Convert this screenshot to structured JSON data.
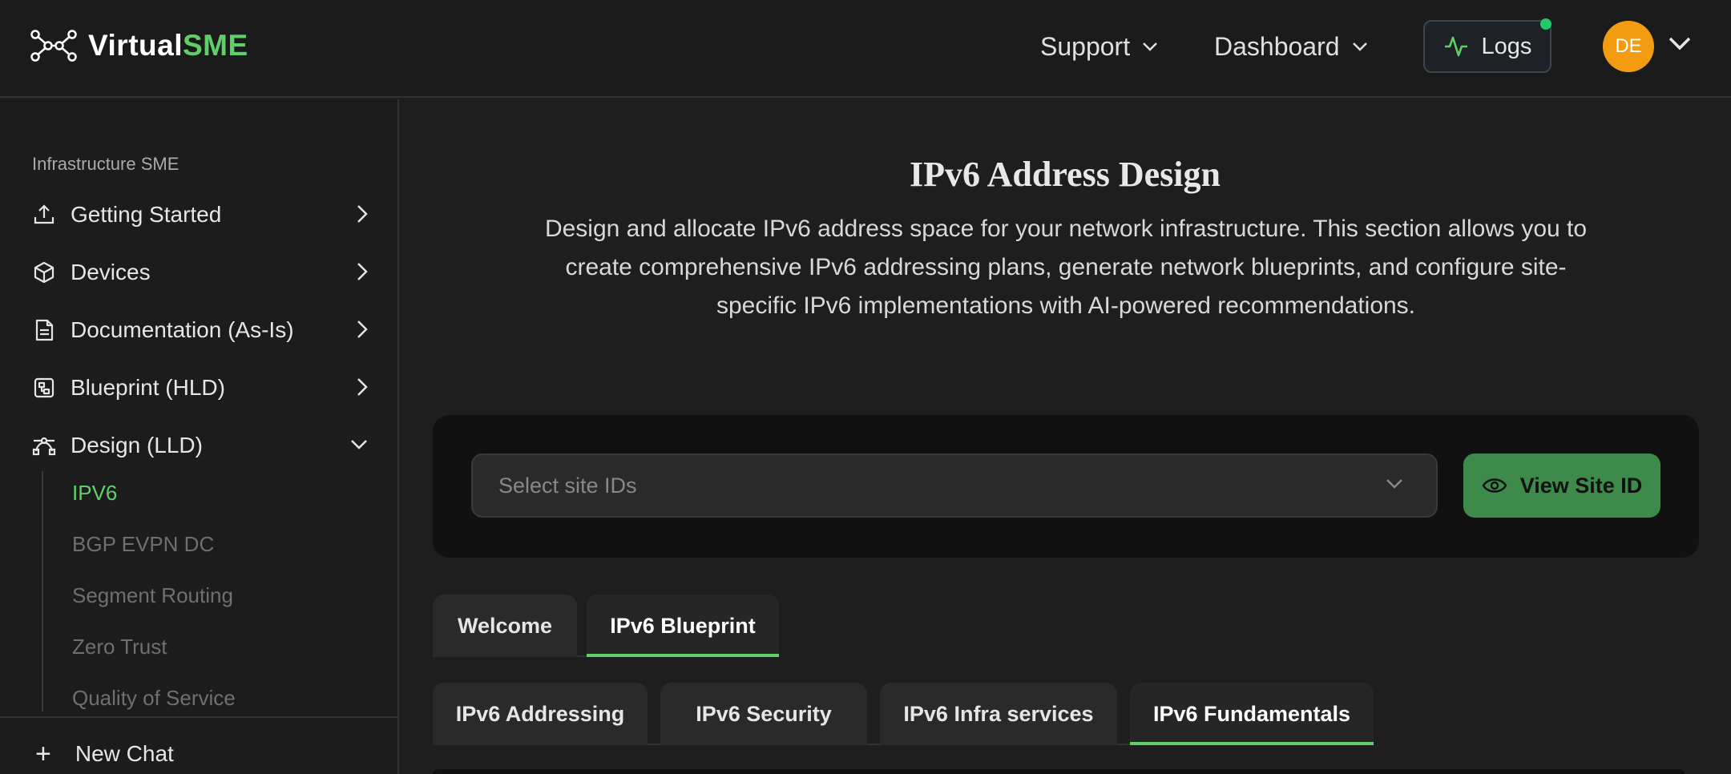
{
  "header": {
    "logo_text_main": "Virtual",
    "logo_text_accent": "SME",
    "nav": [
      {
        "label": "Support"
      },
      {
        "label": "Dashboard"
      }
    ],
    "logs_label": "Logs",
    "avatar_initials": "DE"
  },
  "sidebar": {
    "section_label": "Infrastructure SME",
    "items": [
      {
        "label": "Getting Started",
        "icon": "upload-icon"
      },
      {
        "label": "Devices",
        "icon": "cube-icon"
      },
      {
        "label": "Documentation (As-Is)",
        "icon": "document-icon"
      },
      {
        "label": "Blueprint (HLD)",
        "icon": "blueprint-icon"
      },
      {
        "label": "Design (LLD)",
        "icon": "bezier-icon"
      }
    ],
    "sub_items": [
      {
        "label": "IPV6",
        "active": true
      },
      {
        "label": "BGP EVPN DC"
      },
      {
        "label": "Segment Routing"
      },
      {
        "label": "Zero Trust"
      },
      {
        "label": "Quality of Service"
      }
    ],
    "new_chat_label": "New Chat"
  },
  "main": {
    "title": "IPv6 Address Design",
    "description": "Design and allocate IPv6 address space for your network infrastructure. This section allows you to create comprehensive IPv6 addressing plans, generate network blueprints, and configure site-specific IPv6 implementations with AI-powered recommendations.",
    "site_select_placeholder": "Select site IDs",
    "view_site_button": "View Site ID",
    "tabs": [
      {
        "label": "Welcome"
      },
      {
        "label": "IPv6 Blueprint",
        "active": true
      }
    ],
    "sub_tabs": [
      {
        "label": "IPv6 Addressing"
      },
      {
        "label": "IPv6 Security"
      },
      {
        "label": "IPv6 Infra services"
      },
      {
        "label": "IPv6 Fundamentals",
        "active": true
      }
    ]
  },
  "colors": {
    "accent": "#5fd068",
    "background": "#1e1e1e",
    "avatar": "#f39c12",
    "view_button": "#3d8a4a",
    "logs_dot": "#26c96a"
  }
}
